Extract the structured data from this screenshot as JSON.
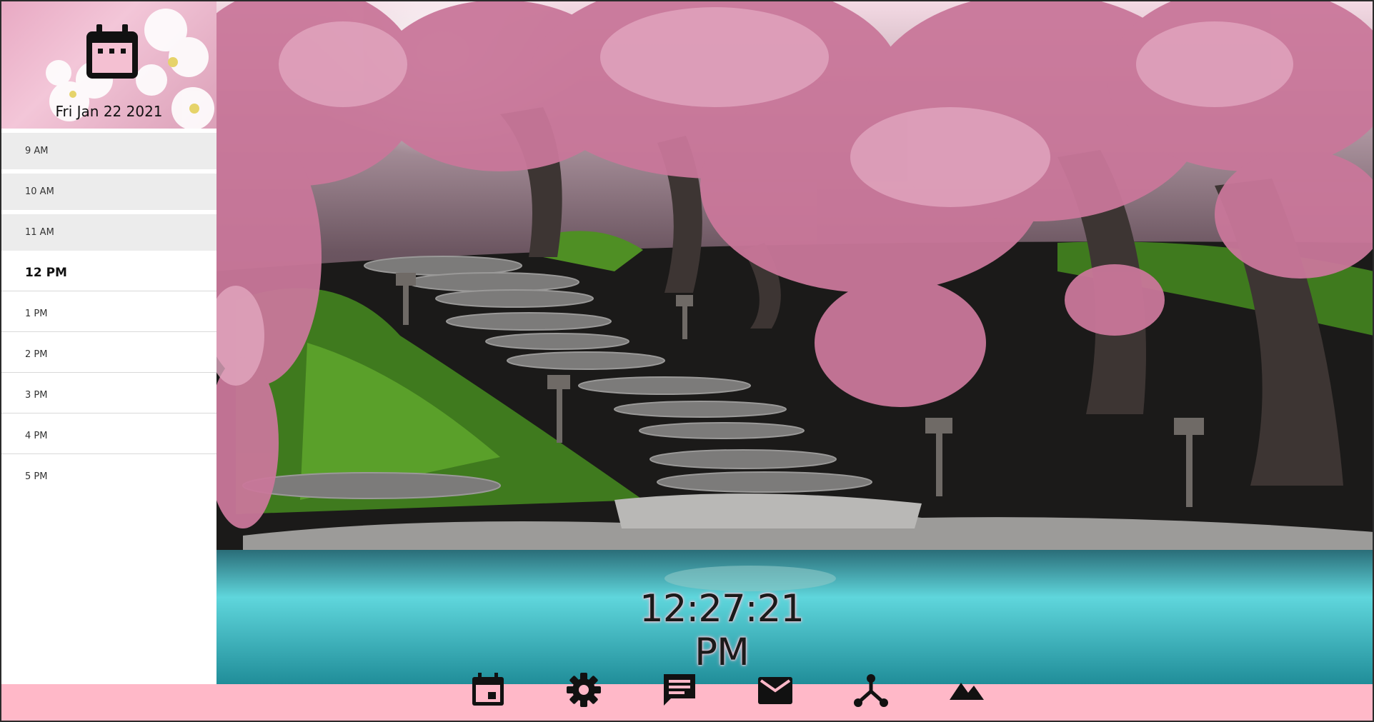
{
  "calendar": {
    "date_label": "Fri Jan 22 2021",
    "icon": "calendar-icon"
  },
  "schedule": {
    "hours": [
      {
        "label": "9 AM",
        "state": "past"
      },
      {
        "label": "10 AM",
        "state": "past"
      },
      {
        "label": "11 AM",
        "state": "past"
      },
      {
        "label": "12 PM",
        "state": "current"
      },
      {
        "label": "1 PM",
        "state": "upcoming"
      },
      {
        "label": "2 PM",
        "state": "upcoming"
      },
      {
        "label": "3 PM",
        "state": "upcoming"
      },
      {
        "label": "4 PM",
        "state": "upcoming"
      },
      {
        "label": "5 PM",
        "state": "upcoming"
      }
    ]
  },
  "clock": {
    "time": "12:27:21 PM"
  },
  "taskbar": {
    "items": [
      {
        "icon": "calendar-icon"
      },
      {
        "icon": "gear-icon"
      },
      {
        "icon": "chat-icon"
      },
      {
        "icon": "mail-icon"
      },
      {
        "icon": "network-icon"
      },
      {
        "icon": "landscape-icon"
      }
    ]
  },
  "colors": {
    "taskbar": "#ffb8c8",
    "sidebar": "#ffffff",
    "past_hour": "#ececec",
    "icon": "#111111",
    "water": "#5fd6dc",
    "blossom": "#c9779a"
  }
}
